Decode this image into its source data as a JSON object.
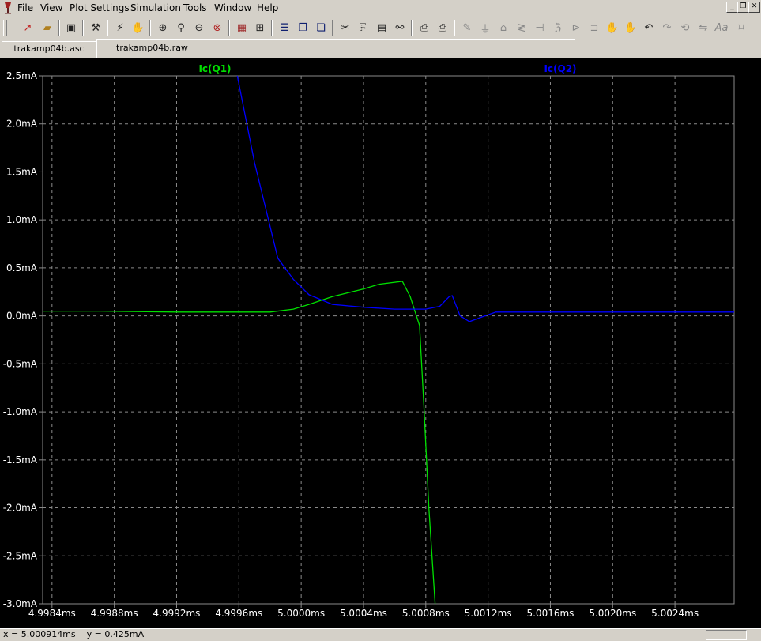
{
  "menu": [
    "File",
    "View",
    "Plot Settings",
    "Simulation",
    "Tools",
    "Window",
    "Help"
  ],
  "window_controls": [
    "_",
    "❐",
    "✕"
  ],
  "toolbar_icons": [
    "new-schematic-icon",
    "open-icon",
    "save-icon",
    "control-panel-icon",
    "run-icon",
    "halt-icon",
    "zoom-area-icon",
    "zoom-in-icon",
    "zoom-out-icon",
    "zoom-cancel-icon",
    "autorange-icon",
    "grid-icon",
    "tile-horizontal-icon",
    "cascade-icon",
    "tile-icon",
    "cut-icon",
    "copy-icon",
    "paste-icon",
    "find-icon",
    "print-setup-icon",
    "print-icon",
    "wire-icon",
    "ground-icon",
    "label-net-icon",
    "resistor-icon",
    "capacitor-icon",
    "inductor-icon",
    "diode-icon",
    "component-icon",
    "move-icon",
    "drag-icon",
    "undo-icon",
    "redo-icon",
    "rotate-icon",
    "mirror-icon",
    "text-icon",
    "spice-directive-icon"
  ],
  "tabs": [
    {
      "label": "trakamp04b.asc",
      "active": false
    },
    {
      "label": "trakamp04b.raw",
      "active": true
    }
  ],
  "colors": {
    "q1": "#00e000",
    "q2": "#0000ff",
    "grid": "#8a8a8a",
    "axis_text": "#ffffff",
    "background": "#000000"
  },
  "chart_data": {
    "type": "line",
    "title": "",
    "xlabel": "",
    "ylabel": "",
    "xlim": [
      4.99834,
      5.00278
    ],
    "ylim": [
      -3.0,
      2.5
    ],
    "x_ticks": [
      4.9984,
      4.9988,
      4.9992,
      4.9996,
      5.0,
      5.0004,
      5.0008,
      5.0012,
      5.0016,
      5.002,
      5.0024
    ],
    "x_tick_labels": [
      "4.9984ms",
      "4.9988ms",
      "4.9992ms",
      "4.9996ms",
      "5.0000ms",
      "5.0004ms",
      "5.0008ms",
      "5.0012ms",
      "5.0016ms",
      "5.0020ms",
      "5.0024ms"
    ],
    "y_ticks": [
      2.5,
      2.0,
      1.5,
      1.0,
      0.5,
      0.0,
      -0.5,
      -1.0,
      -1.5,
      -2.0,
      -2.5,
      -3.0
    ],
    "y_tick_labels": [
      "2.5mA",
      "2.0mA",
      "1.5mA",
      "1.0mA",
      "0.5mA",
      "0.0mA",
      "-0.5mA",
      "-1.0mA",
      "-1.5mA",
      "-2.0mA",
      "-2.5mA",
      "-3.0mA"
    ],
    "grid": true,
    "series": [
      {
        "name": "Ic(Q1)",
        "color": "#00e000",
        "points": [
          [
            4.99834,
            0.05
          ],
          [
            4.9987,
            0.05
          ],
          [
            4.9992,
            0.04
          ],
          [
            4.9998,
            0.04
          ],
          [
            4.99995,
            0.07
          ],
          [
            5.00005,
            0.12
          ],
          [
            5.0002,
            0.2
          ],
          [
            5.0004,
            0.28
          ],
          [
            5.0005,
            0.33
          ],
          [
            5.00065,
            0.36
          ],
          [
            5.0007,
            0.2
          ],
          [
            5.00076,
            -0.1
          ],
          [
            5.00079,
            -1.0
          ],
          [
            5.00082,
            -2.0
          ],
          [
            5.00086,
            -3.0
          ]
        ]
      },
      {
        "name": "Ic(Q2)",
        "color": "#0000ff",
        "points": [
          [
            4.99959,
            2.5
          ],
          [
            4.9997,
            1.6
          ],
          [
            4.99985,
            0.6
          ],
          [
            4.99995,
            0.38
          ],
          [
            5.00005,
            0.22
          ],
          [
            5.0002,
            0.12
          ],
          [
            5.0004,
            0.09
          ],
          [
            5.0006,
            0.07
          ],
          [
            5.0008,
            0.07
          ],
          [
            5.00089,
            0.1
          ],
          [
            5.00095,
            0.2
          ],
          [
            5.00097,
            0.21
          ],
          [
            5.00102,
            0.0
          ],
          [
            5.00108,
            -0.06
          ],
          [
            5.00118,
            0.0
          ],
          [
            5.00125,
            0.04
          ],
          [
            5.0016,
            0.04
          ],
          [
            5.00278,
            0.04
          ]
        ]
      }
    ]
  },
  "status": {
    "text": "x = 5.000914ms    y = 0.425mA"
  }
}
